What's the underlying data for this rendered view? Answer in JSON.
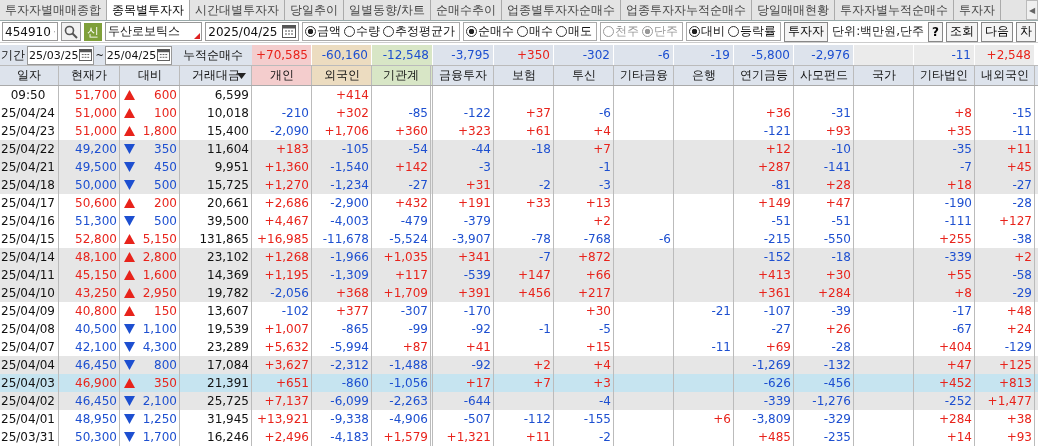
{
  "tabs": [
    {
      "label": "투자자별매매종합",
      "selected": false
    },
    {
      "label": "종목별투자자",
      "selected": true
    },
    {
      "label": "시간대별투자자",
      "selected": false
    },
    {
      "label": "당일추이",
      "selected": false
    },
    {
      "label": "일별동향/차트",
      "selected": false
    },
    {
      "label": "순매수추이",
      "selected": false
    },
    {
      "label": "업종별투자자순매수",
      "selected": false
    },
    {
      "label": "업종투자자누적순매수",
      "selected": false
    },
    {
      "label": "당일매매현황",
      "selected": false
    },
    {
      "label": "투자자별누적순매수",
      "selected": false
    },
    {
      "label": "투자자",
      "selected": false
    }
  ],
  "tab_scroll": "◀",
  "stock_code": {
    "value": "454910"
  },
  "stock_badge": "신",
  "stock_name": {
    "value": "두산로보틱스"
  },
  "date": {
    "value": "2025/04/25"
  },
  "radio_groups": [
    {
      "disabled": false,
      "options": [
        {
          "label": "금액",
          "selected": true
        },
        {
          "label": "수량",
          "selected": false
        },
        {
          "label": "추정평균가",
          "selected": false
        }
      ]
    },
    {
      "disabled": false,
      "options": [
        {
          "label": "순매수",
          "selected": true
        },
        {
          "label": "매수",
          "selected": false
        },
        {
          "label": "매도",
          "selected": false
        }
      ]
    },
    {
      "disabled": true,
      "options": [
        {
          "label": "천주",
          "selected": false
        },
        {
          "label": "단주",
          "selected": true
        }
      ]
    },
    {
      "disabled": false,
      "options": [
        {
          "label": "대비",
          "selected": true
        },
        {
          "label": "등락률",
          "selected": false
        }
      ]
    }
  ],
  "investor_button": "투자자",
  "unit_label": "단위:백만원,단주",
  "buttons": [
    "?",
    "조회",
    "다음",
    "차"
  ],
  "period": {
    "label": "기간",
    "start": "25/03/25",
    "separator": "~",
    "end": "25/04/25"
  },
  "cumulative": {
    "label": "누적순매수",
    "net": {
      "individual": "+70,585",
      "foreign": "-60,160",
      "institution": "-12,548",
      "financial_investment": "-3,795",
      "insurance": "+350",
      "investment_trust": "-302",
      "other_finance": "-6",
      "bank": "-19",
      "pension": "-5,800",
      "private_fund": "-2,976",
      "other_corporation": "-11",
      "domestic_foreign": "+2,548"
    }
  },
  "table": {
    "columns": [
      {
        "label": "일자"
      },
      {
        "label": "현재가"
      },
      {
        "label": "대비"
      },
      {
        "label": "거래대금"
      },
      {
        "label": "개인",
        "color": "#f4cdcd"
      },
      {
        "label": "외국인",
        "color": "#ecdcc0"
      },
      {
        "label": "기관계",
        "color": "#d8e6c6"
      },
      {
        "label": "금융투자"
      },
      {
        "label": "보험"
      },
      {
        "label": "투신"
      },
      {
        "label": "기타금융"
      },
      {
        "label": "은행"
      },
      {
        "label": "연기금등"
      },
      {
        "label": "사모펀드"
      },
      {
        "label": "국가"
      },
      {
        "label": "기타법인"
      },
      {
        "label": "내외국인"
      }
    ],
    "rows": [
      {
        "date": "09:50",
        "price": "51,700",
        "rising": true,
        "change": "600",
        "amount": "6,599",
        "shaded": false,
        "selected": false,
        "net": {
          "foreign": "+414"
        }
      },
      {
        "date": "25/04/24",
        "price": "51,000",
        "rising": true,
        "change": "100",
        "amount": "10,018",
        "shaded": false,
        "selected": false,
        "net": {
          "individual": "-210",
          "foreign": "+302",
          "institution": "-85",
          "financial_investment": "-122",
          "insurance": "+37",
          "investment_trust": "-6",
          "pension": "+36",
          "private_fund": "-31",
          "other_corporation": "+8",
          "domestic_foreign": "-15"
        }
      },
      {
        "date": "25/04/23",
        "price": "51,000",
        "rising": true,
        "change": "1,800",
        "amount": "15,400",
        "shaded": false,
        "selected": false,
        "net": {
          "individual": "-2,090",
          "foreign": "+1,706",
          "institution": "+360",
          "financial_investment": "+323",
          "insurance": "+61",
          "investment_trust": "+4",
          "pension": "-121",
          "private_fund": "+93",
          "other_corporation": "+35",
          "domestic_foreign": "-11"
        }
      },
      {
        "date": "25/04/22",
        "price": "49,200",
        "rising": false,
        "change": "350",
        "amount": "11,604",
        "shaded": true,
        "selected": false,
        "net": {
          "individual": "+183",
          "foreign": "-105",
          "institution": "-54",
          "financial_investment": "-44",
          "insurance": "-18",
          "investment_trust": "+7",
          "pension": "+12",
          "private_fund": "-10",
          "other_corporation": "-35",
          "domestic_foreign": "+11"
        }
      },
      {
        "date": "25/04/21",
        "price": "49,500",
        "rising": false,
        "change": "450",
        "amount": "9,951",
        "shaded": true,
        "selected": false,
        "net": {
          "individual": "+1,360",
          "foreign": "-1,540",
          "institution": "+142",
          "financial_investment": "-3",
          "investment_trust": "-1",
          "pension": "+287",
          "private_fund": "-141",
          "other_corporation": "-7",
          "domestic_foreign": "+45"
        }
      },
      {
        "date": "25/04/18",
        "price": "50,000",
        "rising": false,
        "change": "500",
        "amount": "15,725",
        "shaded": true,
        "selected": false,
        "net": {
          "individual": "+1,270",
          "foreign": "-1,234",
          "institution": "-27",
          "financial_investment": "+31",
          "insurance": "-2",
          "investment_trust": "-3",
          "pension": "-81",
          "private_fund": "+28",
          "other_corporation": "+18",
          "domestic_foreign": "-27"
        }
      },
      {
        "date": "25/04/17",
        "price": "50,600",
        "rising": true,
        "change": "200",
        "amount": "20,661",
        "shaded": false,
        "selected": false,
        "net": {
          "individual": "+2,686",
          "foreign": "-2,900",
          "institution": "+432",
          "financial_investment": "+191",
          "insurance": "+33",
          "investment_trust": "+13",
          "pension": "+149",
          "private_fund": "+47",
          "other_corporation": "-190",
          "domestic_foreign": "-28"
        }
      },
      {
        "date": "25/04/16",
        "price": "51,300",
        "rising": false,
        "change": "500",
        "amount": "39,500",
        "shaded": false,
        "selected": false,
        "net": {
          "individual": "+4,467",
          "foreign": "-4,003",
          "institution": "-479",
          "financial_investment": "-379",
          "investment_trust": "+2",
          "pension": "-51",
          "private_fund": "-51",
          "other_corporation": "-111",
          "domestic_foreign": "+127"
        }
      },
      {
        "date": "25/04/15",
        "price": "52,800",
        "rising": true,
        "change": "5,150",
        "amount": "131,865",
        "shaded": false,
        "selected": false,
        "net": {
          "individual": "+16,985",
          "foreign": "-11,678",
          "institution": "-5,524",
          "financial_investment": "-3,907",
          "insurance": "-78",
          "investment_trust": "-768",
          "other_finance": "-6",
          "pension": "-215",
          "private_fund": "-550",
          "other_corporation": "+255",
          "domestic_foreign": "-38"
        }
      },
      {
        "date": "25/04/14",
        "price": "48,100",
        "rising": true,
        "change": "2,800",
        "amount": "23,102",
        "shaded": true,
        "selected": false,
        "net": {
          "individual": "+1,268",
          "foreign": "-1,966",
          "institution": "+1,035",
          "financial_investment": "+341",
          "insurance": "-7",
          "investment_trust": "+872",
          "pension": "-152",
          "private_fund": "-18",
          "other_corporation": "-339",
          "domestic_foreign": "+2"
        }
      },
      {
        "date": "25/04/11",
        "price": "45,150",
        "rising": true,
        "change": "1,600",
        "amount": "14,369",
        "shaded": true,
        "selected": false,
        "net": {
          "individual": "+1,195",
          "foreign": "-1,309",
          "institution": "+117",
          "financial_investment": "-539",
          "insurance": "+147",
          "investment_trust": "+66",
          "pension": "+413",
          "private_fund": "+30",
          "other_corporation": "+55",
          "domestic_foreign": "-58"
        }
      },
      {
        "date": "25/04/10",
        "price": "43,250",
        "rising": true,
        "change": "2,950",
        "amount": "19,782",
        "shaded": true,
        "selected": false,
        "net": {
          "individual": "-2,056",
          "foreign": "+368",
          "institution": "+1,709",
          "financial_investment": "+391",
          "insurance": "+456",
          "investment_trust": "+217",
          "pension": "+361",
          "private_fund": "+284",
          "other_corporation": "+8",
          "domestic_foreign": "-29"
        }
      },
      {
        "date": "25/04/09",
        "price": "40,800",
        "rising": true,
        "change": "150",
        "amount": "13,607",
        "shaded": false,
        "selected": false,
        "net": {
          "individual": "-102",
          "foreign": "+377",
          "institution": "-307",
          "financial_investment": "-170",
          "investment_trust": "+30",
          "bank": "-21",
          "pension": "-107",
          "private_fund": "-39",
          "other_corporation": "-17",
          "domestic_foreign": "+48"
        }
      },
      {
        "date": "25/04/08",
        "price": "40,500",
        "rising": false,
        "change": "1,100",
        "amount": "19,539",
        "shaded": false,
        "selected": false,
        "net": {
          "individual": "+1,007",
          "foreign": "-865",
          "institution": "-99",
          "financial_investment": "-92",
          "insurance": "-1",
          "investment_trust": "-5",
          "pension": "-27",
          "private_fund": "+26",
          "other_corporation": "-67",
          "domestic_foreign": "+24"
        }
      },
      {
        "date": "25/04/07",
        "price": "42,100",
        "rising": false,
        "change": "4,300",
        "amount": "23,289",
        "shaded": false,
        "selected": false,
        "net": {
          "individual": "+5,632",
          "foreign": "-5,994",
          "institution": "+87",
          "financial_investment": "+41",
          "investment_trust": "+15",
          "bank": "-11",
          "pension": "+69",
          "private_fund": "-28",
          "other_corporation": "+404",
          "domestic_foreign": "-129"
        }
      },
      {
        "date": "25/04/04",
        "price": "46,450",
        "rising": false,
        "change": "800",
        "amount": "17,084",
        "shaded": true,
        "selected": false,
        "net": {
          "individual": "+3,627",
          "foreign": "-2,312",
          "institution": "-1,488",
          "financial_investment": "-92",
          "insurance": "+2",
          "investment_trust": "+4",
          "pension": "-1,269",
          "private_fund": "-132",
          "other_corporation": "+47",
          "domestic_foreign": "+125"
        }
      },
      {
        "date": "25/04/03",
        "price": "46,900",
        "rising": true,
        "change": "350",
        "amount": "21,391",
        "shaded": true,
        "selected": true,
        "net": {
          "individual": "+651",
          "foreign": "-860",
          "institution": "-1,056",
          "financial_investment": "+17",
          "insurance": "+7",
          "investment_trust": "+3",
          "pension": "-626",
          "private_fund": "-456",
          "other_corporation": "+452",
          "domestic_foreign": "+813"
        }
      },
      {
        "date": "25/04/02",
        "price": "46,450",
        "rising": false,
        "change": "2,100",
        "amount": "25,725",
        "shaded": true,
        "selected": false,
        "net": {
          "individual": "+7,137",
          "foreign": "-6,099",
          "institution": "-2,263",
          "financial_investment": "-644",
          "investment_trust": "-4",
          "pension": "-339",
          "private_fund": "-1,276",
          "other_corporation": "-252",
          "domestic_foreign": "+1,477"
        }
      },
      {
        "date": "25/04/01",
        "price": "48,950",
        "rising": false,
        "change": "1,250",
        "amount": "31,945",
        "shaded": false,
        "selected": false,
        "net": {
          "individual": "+13,921",
          "foreign": "-9,338",
          "institution": "-4,906",
          "financial_investment": "-507",
          "insurance": "-112",
          "investment_trust": "-155",
          "bank": "+6",
          "pension": "-3,809",
          "private_fund": "-329",
          "other_corporation": "+284",
          "domestic_foreign": "+38"
        }
      },
      {
        "date": "25/03/31",
        "price": "50,300",
        "rising": false,
        "change": "1,700",
        "amount": "16,246",
        "shaded": false,
        "selected": false,
        "net": {
          "individual": "+2,496",
          "foreign": "-4,183",
          "institution": "+1,579",
          "financial_investment": "+1,321",
          "insurance": "+11",
          "investment_trust": "-2",
          "pension": "+485",
          "private_fund": "-235",
          "other_corporation": "+14",
          "domestic_foreign": "+93"
        }
      }
    ]
  }
}
